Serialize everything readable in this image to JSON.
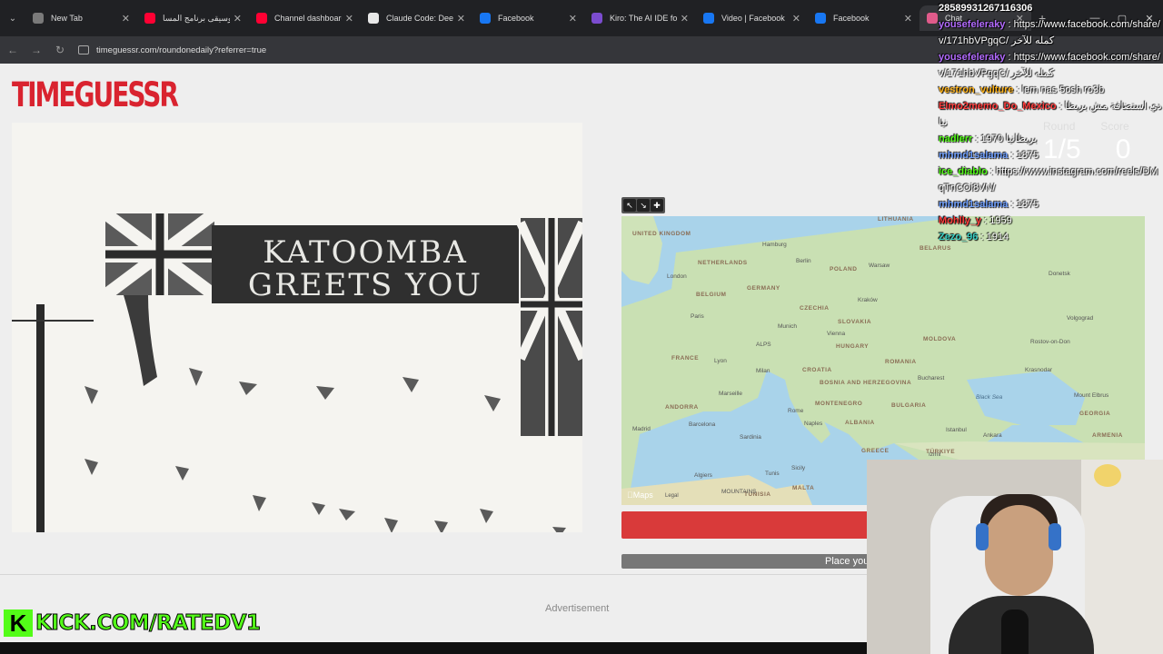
{
  "browser": {
    "tabs": [
      {
        "title": "New Tab",
        "color": "#7a7a7a",
        "active": false
      },
      {
        "title": "موسيقى برنامج المسا",
        "color": "#ff0033",
        "active": false
      },
      {
        "title": "Channel dashboard",
        "color": "#ff0033",
        "active": false
      },
      {
        "title": "Claude Code: Deep",
        "color": "#e8e8e8",
        "active": false
      },
      {
        "title": "Facebook",
        "color": "#1877f2",
        "active": false
      },
      {
        "title": "Kiro: The AI IDE for p",
        "color": "#7b4ccf",
        "active": false
      },
      {
        "title": "Video | Facebook",
        "color": "#1877f2",
        "active": false
      },
      {
        "title": "Facebook",
        "color": "#1877f2",
        "active": false
      },
      {
        "title": "Chat",
        "color": "#e05b8b",
        "active": true
      }
    ],
    "url": "timeguessr.com/roundonedaily?referrer=true",
    "new_tab_glyph": "+",
    "tab_close_glyph": "✕",
    "min_glyph": "—",
    "max_glyph": "▢",
    "close_glyph": "✕",
    "back_glyph": "←",
    "forward_glyph": "→",
    "reload_glyph": "↻",
    "tab_list_glyph": "⌄"
  },
  "page": {
    "logo": "TIMEGUESSR",
    "photo_banner_line1": "KATOOMBA",
    "photo_banner_line2": "GREETS YOU",
    "round_label": "Round",
    "score_label": "Score",
    "round_value": "1/5",
    "score_value": "0",
    "place_text": "Place your",
    "advertisement": "Advertisement",
    "map_brand": "Maps",
    "map_legal": "Legal"
  },
  "map": {
    "labels": [
      {
        "text": "UNITED KINGDOM",
        "type": "country"
      },
      {
        "text": "London",
        "type": "city"
      },
      {
        "text": "NETHERLANDS",
        "type": "country"
      },
      {
        "text": "Hamburg",
        "type": "city"
      },
      {
        "text": "Berlin",
        "type": "city"
      },
      {
        "text": "POLAND",
        "type": "country"
      },
      {
        "text": "Warsaw",
        "type": "city"
      },
      {
        "text": "LITHUANIA",
        "type": "country"
      },
      {
        "text": "BELARUS",
        "type": "country"
      },
      {
        "text": "BELGIUM",
        "type": "country"
      },
      {
        "text": "GERMANY",
        "type": "country"
      },
      {
        "text": "CZECHIA",
        "type": "country"
      },
      {
        "text": "Kraków",
        "type": "city"
      },
      {
        "text": "Paris",
        "type": "city"
      },
      {
        "text": "Munich",
        "type": "city"
      },
      {
        "text": "Vienna",
        "type": "city"
      },
      {
        "text": "SLOVAKIA",
        "type": "country"
      },
      {
        "text": "HUNGARY",
        "type": "country"
      },
      {
        "text": "MOLDOVA",
        "type": "country"
      },
      {
        "text": "Rostov-on-Don",
        "type": "city"
      },
      {
        "text": "Volgograd",
        "type": "city"
      },
      {
        "text": "FRANCE",
        "type": "country"
      },
      {
        "text": "Lyon",
        "type": "city"
      },
      {
        "text": "ALPS",
        "type": "region"
      },
      {
        "text": "Milan",
        "type": "city"
      },
      {
        "text": "CROATIA",
        "type": "country"
      },
      {
        "text": "ROMANIA",
        "type": "country"
      },
      {
        "text": "Krasnodar",
        "type": "city"
      },
      {
        "text": "Marseille",
        "type": "city"
      },
      {
        "text": "BOSNIA AND HERZEGOVINA",
        "type": "country"
      },
      {
        "text": "Bucharest",
        "type": "city"
      },
      {
        "text": "Mount Elbrus",
        "type": "city"
      },
      {
        "text": "ANDORRA",
        "type": "country"
      },
      {
        "text": "MONTENEGRO",
        "type": "country"
      },
      {
        "text": "BULGARIA",
        "type": "country"
      },
      {
        "text": "Black Sea",
        "type": "sea"
      },
      {
        "text": "GEORGIA",
        "type": "country"
      },
      {
        "text": "Madrid",
        "type": "city"
      },
      {
        "text": "Barcelona",
        "type": "city"
      },
      {
        "text": "Rome",
        "type": "city"
      },
      {
        "text": "Naples",
        "type": "city"
      },
      {
        "text": "ALBANIA",
        "type": "country"
      },
      {
        "text": "Istanbul",
        "type": "city"
      },
      {
        "text": "Ankara",
        "type": "city"
      },
      {
        "text": "ARMENIA",
        "type": "country"
      },
      {
        "text": "Sardinia",
        "type": "region"
      },
      {
        "text": "GREECE",
        "type": "country"
      },
      {
        "text": "TÜRKIYE",
        "type": "country"
      },
      {
        "text": "Izmir",
        "type": "city"
      },
      {
        "text": "Algiers",
        "type": "city"
      },
      {
        "text": "Tunis",
        "type": "city"
      },
      {
        "text": "Sicily",
        "type": "region"
      },
      {
        "text": "MALTA",
        "type": "country"
      },
      {
        "text": "TUNISIA",
        "type": "country"
      },
      {
        "text": "MOUNTAINS",
        "type": "region"
      },
      {
        "text": "Donetsk",
        "type": "city"
      }
    ]
  },
  "stream": {
    "kick_logo": "K",
    "kick_text": "KICK.COM/RATEDV1"
  },
  "chat": {
    "top_line": "2858993126711630​6",
    "messages": [
      {
        "user": "yousefeleraky",
        "text": "https://www.facebook.com/share/v/171hbVPgqC/ كمله للآخر",
        "color": "#b36bff"
      },
      {
        "user": "yousefeleraky",
        "text": "https://www.facebook.com/share/v/171hbVPgqC/ كمله للآخر",
        "color": "#b36bff"
      },
      {
        "user": "vestron_vulture",
        "text": "lem nas 5osh ro3b",
        "color": "#ffb31a"
      },
      {
        "user": "Elmo2memo_Do_Mexico",
        "text": "دي استضافة مش بريطانيا",
        "color": "#ff3b3b"
      },
      {
        "user": "nadlerr",
        "text": "1970 بريطانيا",
        "color": "#53fc18"
      },
      {
        "user": "mhmd1salama",
        "text": "1875",
        "color": "#6fa0ff"
      },
      {
        "user": "ice_diablo",
        "text": "https://www.instagram.com/reels/DMqTnCOi8VN/",
        "color": "#53fc18"
      },
      {
        "user": "mhmd1salama",
        "text": "1875",
        "color": "#6fa0ff"
      },
      {
        "user": "Mohlly_y",
        "text": "1959",
        "color": "#ff3b3b"
      },
      {
        "user": "Zezo_96",
        "text": "1914",
        "color": "#39d1c5"
      }
    ]
  }
}
